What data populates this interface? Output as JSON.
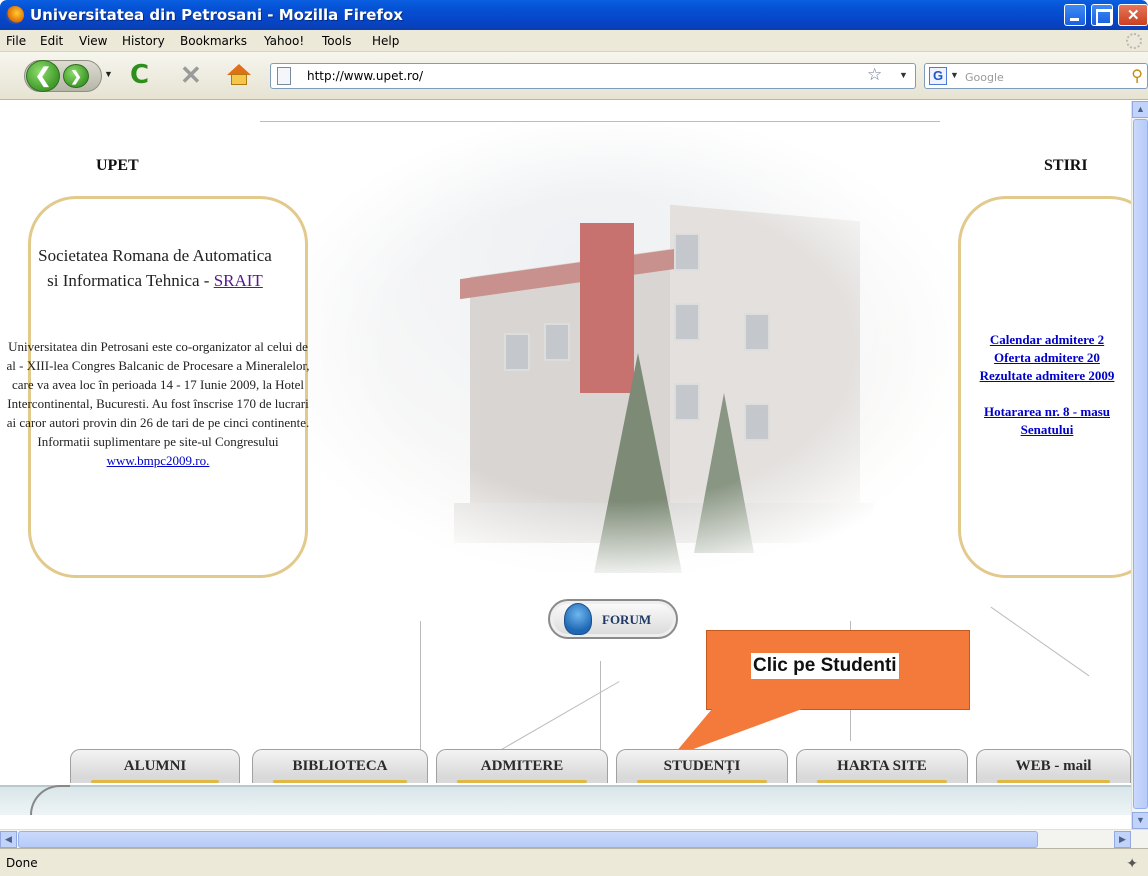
{
  "window": {
    "title": "Universitatea din Petrosani - Mozilla Firefox"
  },
  "menu": {
    "items": [
      "File",
      "Edit",
      "View",
      "History",
      "Bookmarks",
      "Yahoo!",
      "Tools",
      "Help"
    ]
  },
  "navigation": {
    "url": "http://www.upet.ro/",
    "search_placeholder": "Google",
    "search_engine_letter": "G"
  },
  "page": {
    "left_heading": "UPET",
    "right_heading": "STIRI",
    "left_box": {
      "title_prefix": "Societatea Romana de Automatica si Informatica Tehnica - ",
      "title_link": "SRAIT",
      "body": "Universitatea din Petrosani este co-organizator al celui de al - XIII-lea Congres Balcanic de Procesare a Mineralelor, care va avea loc în perioada 14 - 17 Iunie 2009, la Hotel Intercontinental, Bucuresti. Au fost înscrise 170 de lucrari ai caror autori provin din 26 de tari de pe cinci continente. Informatii suplimentare pe site-ul Congresului ",
      "body_link": "www.bmpc2009.ro."
    },
    "news": [
      "Calendar admitere 2",
      "Oferta admitere 20",
      "Rezultate admitere 2009",
      "",
      "Hotararea nr. 8 - masu",
      "Senatului"
    ],
    "forum_label": "FORUM",
    "callout_text": "Clic pe Studenti",
    "tabs": [
      "ALUMNI",
      "BIBLIOTECA",
      "ADMITERE",
      "STUDENȚI",
      "HARTA SITE",
      "WEB - mail"
    ]
  },
  "status": {
    "text": "Done"
  },
  "colors": {
    "titlebar": "#0551d4",
    "callout": "#f47a3c",
    "box_border": "#e2c98c",
    "link": "#0000cc"
  }
}
